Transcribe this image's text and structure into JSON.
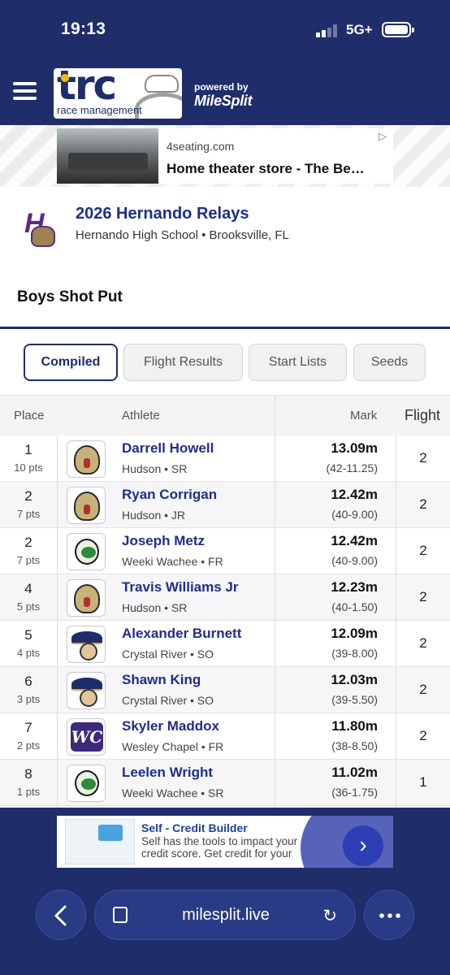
{
  "status_bar": {
    "time": "19:13",
    "network": "5G+"
  },
  "header": {
    "powered_by": "powered by",
    "brand": "MileSplit",
    "logo_text": "trc",
    "logo_sub": "race management"
  },
  "ad_top": {
    "domain": "4seating.com",
    "headline": "Home theater store - The Be…"
  },
  "meet": {
    "title": "2026 Hernando Relays",
    "subtitle": "Hernando High School • Brooksville, FL",
    "logo_letter": "H"
  },
  "event": {
    "title": "Boys Shot Put"
  },
  "tabs": [
    {
      "label": "Compiled",
      "active": true
    },
    {
      "label": "Flight Results",
      "active": false
    },
    {
      "label": "Start Lists",
      "active": false
    },
    {
      "label": "Seeds",
      "active": false
    }
  ],
  "table": {
    "headers": {
      "place": "Place",
      "athlete": "Athlete",
      "mark": "Mark",
      "flight": "Flight"
    },
    "rows": [
      {
        "place": "1",
        "pts": "10 pts",
        "name": "Darrell Howell",
        "team": "Hudson • SR",
        "mark": "13.09m",
        "imperial": "(42-11.25)",
        "flight": "2",
        "logo": "cobra-icon"
      },
      {
        "place": "2",
        "pts": "7 pts",
        "name": "Ryan Corrigan",
        "team": "Hudson • JR",
        "mark": "12.42m",
        "imperial": "(40-9.00)",
        "flight": "2",
        "logo": "cobra-icon"
      },
      {
        "place": "2",
        "pts": "7 pts",
        "name": "Joseph Metz",
        "team": "Weeki Wachee • FR",
        "mark": "12.42m",
        "imperial": "(40-9.00)",
        "flight": "2",
        "logo": "hornet-icon"
      },
      {
        "place": "4",
        "pts": "5 pts",
        "name": "Travis Williams Jr",
        "team": "Hudson • SR",
        "mark": "12.23m",
        "imperial": "(40-1.50)",
        "flight": "2",
        "logo": "cobra-icon"
      },
      {
        "place": "5",
        "pts": "4 pts",
        "name": "Alexander Burnett",
        "team": "Crystal River • SO",
        "mark": "12.09m",
        "imperial": "(39-8.00)",
        "flight": "2",
        "logo": "pirate-icon"
      },
      {
        "place": "6",
        "pts": "3 pts",
        "name": "Shawn King",
        "team": "Crystal River • SO",
        "mark": "12.03m",
        "imperial": "(39-5.50)",
        "flight": "2",
        "logo": "pirate-icon"
      },
      {
        "place": "7",
        "pts": "2 pts",
        "name": "Skyler Maddox",
        "team": "Wesley Chapel • FR",
        "mark": "11.80m",
        "imperial": "(38-8.50)",
        "flight": "2",
        "logo": "wc-icon"
      },
      {
        "place": "8",
        "pts": "1 pts",
        "name": "Leelen Wright",
        "team": "Weeki Wachee • SR",
        "mark": "11.02m",
        "imperial": "(36-1.75)",
        "flight": "1",
        "logo": "hornet-icon"
      }
    ]
  },
  "ad_bottom": {
    "title": "Self - Credit Builder",
    "text": "Self has the tools to impact your credit score. Get credit for your"
  },
  "browser": {
    "url": "milesplit.live"
  },
  "colors": {
    "navy": "#1f2d6b",
    "link": "#1f2d8a"
  }
}
